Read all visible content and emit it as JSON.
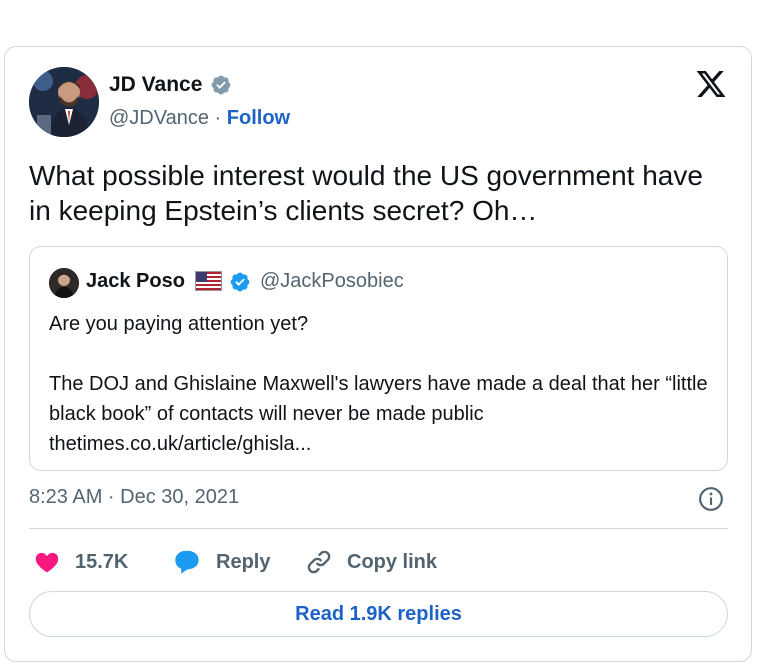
{
  "author": {
    "name": "JD Vance",
    "handle": "@JDVance",
    "separator": "·",
    "follow_label": "Follow",
    "verified_icon": "verified-badge-gray"
  },
  "tweet": {
    "text": "What possible interest would the US government have in keeping Epstein’s clients secret? Oh…",
    "timestamp": "8:23 AM · Dec 30, 2021"
  },
  "quote": {
    "name": "Jack Poso",
    "flag_icon": "us-flag",
    "verified_icon": "verified-badge-blue",
    "handle": "@JackPosobiec",
    "line1": "Are you paying attention yet?",
    "line2": "The DOJ and Ghislaine Maxwell's lawyers have made a deal that her “little black book” of contacts will never be made public",
    "link": "thetimes.co.uk/article/ghisla..."
  },
  "actions": {
    "like_count": "15.7K",
    "reply_label": "Reply",
    "copy_label": "Copy link"
  },
  "footer": {
    "read_replies_label": "Read 1.9K replies"
  },
  "colors": {
    "like": "#f91880",
    "reply": "#1d9bf0",
    "link_blue": "#1d63c7",
    "verified_blue": "#1d9bf0"
  }
}
